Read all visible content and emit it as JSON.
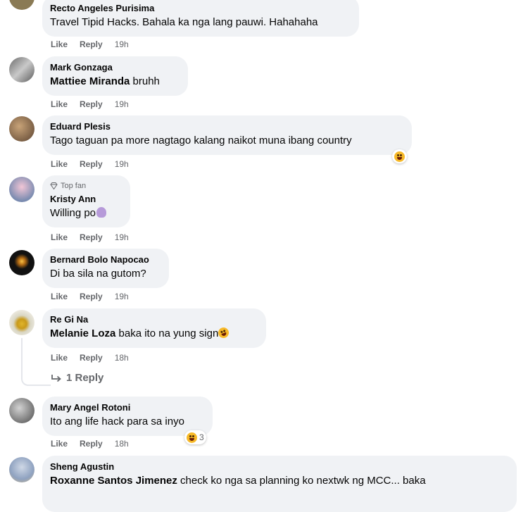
{
  "comments": [
    {
      "author": "Recto Angeles Purisima",
      "text": "Travel Tipid Hacks. Bahala ka nga lang pauwi. Hahahaha",
      "like": "Like",
      "reply": "Reply",
      "time": "19h"
    },
    {
      "author": "Mark Gonzaga",
      "tag": "Mattiee Miranda",
      "text": " bruhh",
      "like": "Like",
      "reply": "Reply",
      "time": "19h"
    },
    {
      "author": "Eduard Plesis",
      "text": "Tago taguan pa more nagtago kalang naikot muna ibang country",
      "like": "Like",
      "reply": "Reply",
      "time": "19h"
    },
    {
      "badge": "Top fan",
      "author": "Kristy Ann",
      "text": "Willing po",
      "like": "Like",
      "reply": "Reply",
      "time": "19h"
    },
    {
      "author": "Bernard Bolo Napocao",
      "text": "Di ba sila na gutom?",
      "like": "Like",
      "reply": "Reply",
      "time": "19h"
    },
    {
      "author": "Re Gi Na",
      "tag": "Melanie Loza",
      "text": " baka ito na yung sign",
      "like": "Like",
      "reply": "Reply",
      "time": "18h",
      "replies": "1 Reply"
    },
    {
      "author": "Mary Angel Rotoni",
      "text": "Ito ang life hack para sa inyo",
      "like": "Like",
      "reply": "Reply",
      "time": "18h",
      "reaction_count": "3"
    },
    {
      "author": "Sheng Agustin",
      "tag": "Roxanne Santos Jimenez",
      "text": " check ko nga sa planning ko nextwk ng MCC... baka"
    }
  ],
  "colors": {
    "bubble": "#f0f2f5",
    "meta": "#65676b",
    "text": "#050505",
    "emoji": "#f7b928"
  }
}
